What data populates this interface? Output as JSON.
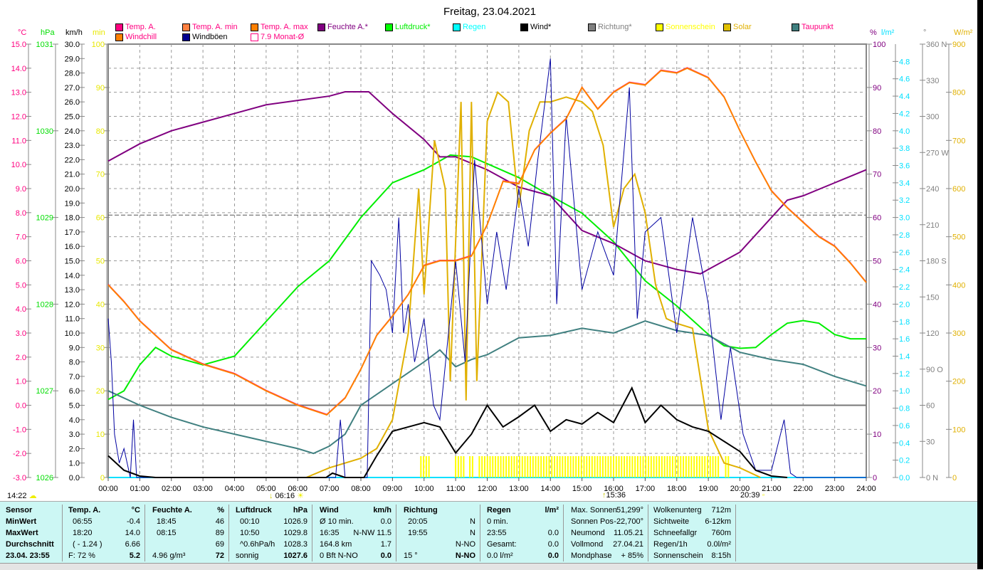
{
  "title": "Freitag, 23.04.2021",
  "legend": [
    {
      "label": "Temp. A.",
      "color": "#ff0080",
      "text": "#ff0080"
    },
    {
      "label": "Temp. A. min",
      "color": "#ff8040",
      "text": "#ff0080"
    },
    {
      "label": "Temp. A. max",
      "color": "#ff8000",
      "text": "#ff0080"
    },
    {
      "label": "Feuchte A.*",
      "color": "#800080",
      "text": "#800080"
    },
    {
      "label": "Luftdruck*",
      "color": "#00ff00",
      "text": "#00ee00"
    },
    {
      "label": "Regen",
      "color": "#00ffff",
      "text": "#00ffff"
    },
    {
      "label": "Wind*",
      "color": "#000000",
      "text": "#000000"
    },
    {
      "label": "Richtung*",
      "color": "#808080",
      "text": "#808080"
    },
    {
      "label": "Sonnenschein",
      "color": "#ffff00",
      "text": "#ffff00"
    },
    {
      "label": "Solar",
      "color": "#e0c000",
      "text": "#e0b000"
    },
    {
      "label": "Taupunkt",
      "color": "#408080",
      "text": "#ff0080"
    },
    {
      "label": "Windchill",
      "color": "#ff8000",
      "text": "#ff0080"
    },
    {
      "label": "Windböen",
      "color": "#000090",
      "text": "#000000"
    },
    {
      "label": "7.9 Monat-Ø",
      "color": "#ffffff",
      "text": "#ff0080"
    }
  ],
  "chart_data": {
    "type": "line",
    "title": "Freitag, 23.04.2021",
    "x_ticks": [
      "00:00",
      "01:00",
      "02:00",
      "03:00",
      "04:00",
      "05:00",
      "06:00",
      "07:00",
      "08:00",
      "09:00",
      "10:00",
      "11:00",
      "12:00",
      "13:00",
      "14:00",
      "15:00",
      "16:00",
      "17:00",
      "18:00",
      "19:00",
      "20:00",
      "21:00",
      "22:00",
      "23:00",
      "24:00"
    ],
    "axes": {
      "temp": {
        "unit": "°C",
        "range": [
          -3,
          15
        ],
        "color": "#ff0080",
        "ticks": [
          "-3.0",
          "-2.0",
          "-1.0",
          "0.0",
          "1.0",
          "2.0",
          "3.0",
          "4.0",
          "5.0",
          "6.0",
          "7.0",
          "8.0",
          "9.0",
          "10.0",
          "11.0",
          "12.0",
          "13.0",
          "14.0",
          "15.0"
        ]
      },
      "pressure": {
        "unit": "hPa",
        "range": [
          1026,
          1031
        ],
        "color": "#00dd00",
        "ticks": [
          "1026",
          "1027",
          "1028",
          "1029",
          "1030",
          "1031"
        ]
      },
      "wind": {
        "unit": "km/h",
        "range": [
          0,
          30
        ],
        "color": "#000000",
        "ticks": [
          "0.0",
          "1.0",
          "2.0",
          "3.0",
          "4.0",
          "5.0",
          "6.0",
          "7.0",
          "8.0",
          "9.0",
          "10.0",
          "11.0",
          "12.0",
          "13.0",
          "14.0",
          "15.0",
          "16.0",
          "17.0",
          "18.0",
          "19.0",
          "20.0",
          "21.0",
          "22.0",
          "23.0",
          "24.0",
          "25.0",
          "26.0",
          "27.0",
          "28.0",
          "29.0",
          "30.0"
        ]
      },
      "sun_min": {
        "unit": "min",
        "range": [
          0,
          100
        ],
        "color": "#e8e800",
        "ticks": [
          "0",
          "10",
          "20",
          "30",
          "40",
          "50",
          "60",
          "70",
          "80",
          "90",
          "100"
        ]
      },
      "humidity": {
        "unit": "%",
        "range": [
          0,
          100
        ],
        "color": "#800080",
        "ticks": [
          "0",
          "10",
          "20",
          "30",
          "40",
          "50",
          "60",
          "70",
          "80",
          "90",
          "100"
        ]
      },
      "rain": {
        "unit": "l/m²",
        "range": [
          0,
          5
        ],
        "color": "#00e0ff",
        "ticks": [
          "0.0",
          "0.2",
          "0.4",
          "0.6",
          "0.8",
          "1.0",
          "1.2",
          "1.4",
          "1.6",
          "1.8",
          "2.0",
          "2.2",
          "2.4",
          "2.6",
          "2.8",
          "3.0",
          "3.2",
          "3.4",
          "3.6",
          "3.8",
          "4.0",
          "4.2",
          "4.4",
          "4.6",
          "4.8"
        ]
      },
      "direction": {
        "unit": "°",
        "range": [
          0,
          360
        ],
        "color": "#808080",
        "ticks": [
          "0  N",
          "30",
          "60",
          "90  O",
          "120",
          "150",
          "180 S",
          "210",
          "240",
          "270 W",
          "300",
          "330",
          "360 N"
        ]
      },
      "solar": {
        "unit": "W/m²",
        "range": [
          0,
          900
        ],
        "color": "#e0b000",
        "ticks": [
          "0",
          "100",
          "200",
          "300",
          "400",
          "500",
          "600",
          "700",
          "800",
          "900"
        ]
      }
    },
    "monthly_avg_temp": 7.9,
    "series": [
      {
        "name": "Luftdruck",
        "axis": "pressure",
        "color": "#00ee00",
        "width": 2,
        "x": [
          0,
          0.5,
          1,
          1.5,
          2,
          3,
          4,
          5,
          6,
          7,
          8,
          9,
          10,
          10.83,
          11.5,
          12,
          13,
          14,
          15,
          16,
          17,
          18,
          19,
          19.5,
          20,
          20.5,
          21,
          21.5,
          22,
          22.5,
          23,
          23.5,
          24
        ],
        "y": [
          1026.9,
          1027.0,
          1027.3,
          1027.5,
          1027.4,
          1027.3,
          1027.4,
          1027.8,
          1028.2,
          1028.5,
          1029.0,
          1029.4,
          1029.55,
          1029.72,
          1029.7,
          1029.62,
          1029.46,
          1029.25,
          1029.05,
          1028.72,
          1028.27,
          1027.98,
          1027.65,
          1027.52,
          1027.49,
          1027.5,
          1027.65,
          1027.78,
          1027.81,
          1027.78,
          1027.65,
          1027.6,
          1027.6
        ]
      },
      {
        "name": "Feuchte A.",
        "axis": "humidity",
        "color": "#800080",
        "width": 2,
        "x": [
          0,
          1,
          2,
          3,
          4,
          5,
          6,
          7,
          7.5,
          8,
          8.25,
          9,
          10,
          10.5,
          11,
          12,
          13,
          14,
          15,
          16,
          17,
          18,
          18.75,
          19,
          20,
          21,
          21.5,
          22,
          23,
          24
        ],
        "y": [
          73,
          77,
          80,
          82,
          84,
          86,
          87,
          88,
          89,
          89,
          89,
          84,
          78,
          74,
          74,
          71,
          67,
          65,
          57,
          54,
          50,
          48,
          47,
          48,
          52,
          60,
          64,
          65,
          68,
          71
        ]
      },
      {
        "name": "Taupunkt",
        "axis": "temp",
        "color": "#408080",
        "width": 2,
        "x": [
          0,
          1,
          2,
          3,
          4,
          5,
          6,
          6.5,
          7,
          7.5,
          8,
          9,
          10,
          10.5,
          11,
          11.5,
          12,
          13,
          14,
          15,
          16,
          17,
          18,
          19,
          20,
          21,
          22,
          23,
          24
        ],
        "y": [
          0.6,
          0.0,
          -0.5,
          -0.9,
          -1.2,
          -1.5,
          -1.8,
          -2.0,
          -1.7,
          -1.2,
          0.0,
          0.9,
          1.8,
          2.3,
          1.6,
          1.9,
          2.1,
          2.8,
          2.9,
          3.2,
          3.0,
          3.5,
          3.1,
          2.9,
          2.2,
          1.9,
          1.7,
          1.2,
          0.8
        ]
      },
      {
        "name": "Solar",
        "axis": "solar",
        "color": "#e0b000",
        "width": 2,
        "x": [
          6.27,
          7,
          8,
          8.5,
          9,
          9.5,
          9.83,
          10,
          10.33,
          10.67,
          10.83,
          11.17,
          11.33,
          11.5,
          11.67,
          12,
          12.33,
          12.67,
          13,
          13.33,
          13.67,
          14,
          14.5,
          15,
          15.33,
          15.67,
          16,
          16.33,
          16.67,
          17,
          17.33,
          17.67,
          18,
          18.5,
          19,
          19.5,
          20,
          20.65
        ],
        "y": [
          0,
          20,
          40,
          60,
          120,
          300,
          600,
          380,
          700,
          600,
          200,
          780,
          160,
          780,
          200,
          740,
          800,
          780,
          560,
          720,
          780,
          780,
          790,
          780,
          760,
          690,
          520,
          600,
          630,
          550,
          400,
          330,
          320,
          310,
          100,
          30,
          20,
          0
        ]
      },
      {
        "name": "Windböen",
        "axis": "wind",
        "color": "#0000a0",
        "width": 1,
        "x": [
          0,
          0.1,
          0.2,
          0.35,
          0.5,
          0.7,
          0.8,
          0.9,
          1.1,
          1.5,
          7.2,
          7.35,
          7.5,
          8.2,
          8.33,
          8.6,
          8.8,
          9,
          9.2,
          9.35,
          9.5,
          9.7,
          10,
          10.3,
          10.5,
          11,
          11.3,
          11.6,
          12,
          12.3,
          12.6,
          13,
          13.3,
          13.6,
          14,
          14.2,
          14.5,
          15,
          15.5,
          16,
          16.5,
          16.75,
          17,
          17.5,
          18,
          18.5,
          19,
          19.4,
          19.7,
          20.1,
          20.5,
          21,
          21.4,
          21.6,
          21.8,
          24
        ],
        "y": [
          11,
          8,
          3,
          1,
          2,
          0,
          4,
          0,
          0,
          0,
          0,
          4,
          0,
          0,
          15,
          14,
          13,
          10,
          18,
          10,
          12,
          8,
          11,
          5,
          4,
          15,
          8,
          22,
          12,
          17,
          13,
          20,
          16,
          22,
          29,
          12,
          25,
          13,
          17,
          14,
          27,
          11,
          17,
          18,
          10,
          18,
          12,
          4,
          9,
          3,
          0.5,
          0.5,
          4,
          0.3,
          0,
          0
        ]
      },
      {
        "name": "Temp. A.",
        "axis": "temp",
        "color": "#ff8000",
        "width": 2,
        "x": [
          0,
          0.5,
          1,
          2,
          3,
          4,
          5,
          6,
          6.92,
          7.5,
          8,
          8.5,
          9,
          9.5,
          10,
          10.5,
          11,
          11.5,
          12,
          12.5,
          13,
          13.5,
          14,
          14.5,
          15,
          15.5,
          16,
          16.5,
          17,
          17.5,
          18,
          18.33,
          19,
          19.5,
          20,
          20.5,
          21,
          21.5,
          22,
          22.5,
          23,
          23.5,
          24
        ],
        "y": [
          5.0,
          4.3,
          3.5,
          2.3,
          1.7,
          1.3,
          0.6,
          0.0,
          -0.4,
          0.3,
          1.5,
          2.9,
          3.7,
          4.6,
          5.8,
          6.0,
          6.0,
          6.2,
          7.5,
          9.3,
          9.2,
          10.6,
          11.3,
          11.9,
          13.2,
          12.3,
          13.0,
          13.4,
          13.3,
          13.9,
          13.8,
          14.0,
          13.6,
          12.8,
          11.4,
          10.1,
          8.9,
          8.2,
          7.6,
          7.0,
          6.6,
          5.9,
          5.1
        ]
      },
      {
        "name": "Wind",
        "axis": "wind",
        "color": "#000000",
        "width": 2,
        "x": [
          0,
          0.5,
          1,
          1.5,
          6.9,
          7.1,
          7.5,
          8.1,
          8.5,
          9,
          9.5,
          10,
          10.5,
          11,
          11.5,
          12,
          12.5,
          13,
          13.5,
          14,
          14.5,
          15,
          15.5,
          16,
          16.58,
          17,
          17.5,
          18,
          18.5,
          19,
          19.5,
          20,
          20.5,
          21,
          21.5
        ],
        "y": [
          1.5,
          0.5,
          0.1,
          0,
          0,
          0.3,
          0,
          0,
          1.5,
          3.2,
          3.5,
          3.8,
          3.5,
          1.7,
          3.0,
          5.0,
          3.5,
          4.2,
          5.0,
          3.2,
          4.0,
          3.7,
          4.5,
          3.8,
          6.2,
          3.8,
          5.0,
          4.0,
          3.5,
          3.2,
          2.5,
          1.8,
          0.5,
          0.1,
          0
        ]
      }
    ],
    "sunshine_intervals": [
      [
        9.9,
        10.2
      ],
      [
        11.0,
        11.3
      ],
      [
        11.45,
        11.6
      ],
      [
        11.75,
        19.4
      ],
      [
        19.55,
        19.7
      ]
    ],
    "markers": {
      "left": "14:22",
      "sunrise": "06:16",
      "moon": "15:36",
      "sunset": "20:39"
    }
  },
  "panel": {
    "sensor": {
      "h": "Sensor",
      "r": [
        "MinWert",
        "MaxWert",
        "Durchschnitt",
        "23.04.  23:55"
      ]
    },
    "temp": {
      "h": "Temp. A.",
      "u": "°C",
      "t": [
        "06:55",
        "18:20",
        "( - 1.24 )",
        "F: 72 %"
      ],
      "v": [
        "-0.4",
        "14.0",
        "6.66",
        "5.2"
      ]
    },
    "hum": {
      "h": "Feuchte A.",
      "u": "%",
      "t": [
        "18:45",
        "08:15",
        "",
        "4.96 g/m³"
      ],
      "v": [
        "46",
        "89",
        "69",
        "72"
      ]
    },
    "press": {
      "h": "Luftdruck",
      "u": "hPa",
      "t": [
        "00:10",
        "10:50",
        "^0.6hPa/h",
        "sonnig"
      ],
      "v": [
        "1026.9",
        "1029.8",
        "1028.3",
        "1027.6"
      ]
    },
    "wind": {
      "h": "Wind",
      "u": "km/h",
      "t": [
        "Ø 10 min.",
        "16:35",
        "164.8 km",
        "0 Bft N-NO"
      ],
      "v": [
        "0.0",
        "N-NW 11.5",
        "1.7",
        "0.0"
      ]
    },
    "dir": {
      "h": "Richtung",
      "u": "",
      "t": [
        "20:05",
        "19:55",
        "",
        "15 °"
      ],
      "v": [
        "N",
        "N",
        "N-NO",
        "N-NO"
      ]
    },
    "rain": {
      "h": "Regen",
      "u": "l/m²",
      "t": [
        "0 min.",
        "23:55",
        "Gesamt:",
        "0.0 l/m²"
      ],
      "v": [
        "",
        "0.0",
        "0.0",
        "0.0"
      ]
    },
    "astro": {
      "t": [
        "Max. Sonnen",
        "Sonnen Pos",
        "Neumond",
        "Vollmond",
        "Mondphase"
      ],
      "v": [
        "51,299°",
        "-22,700°",
        "11.05.21",
        "27.04.21",
        "+ 85%"
      ]
    },
    "misc": {
      "t": [
        "Wolkenunterg",
        "Sichtweite",
        "Schneefallgr",
        "Regen/1h",
        "Sonnenschein"
      ],
      "v": [
        "712m",
        "6-12km",
        "760m",
        "0.0l/m²",
        "8:15h"
      ]
    }
  }
}
